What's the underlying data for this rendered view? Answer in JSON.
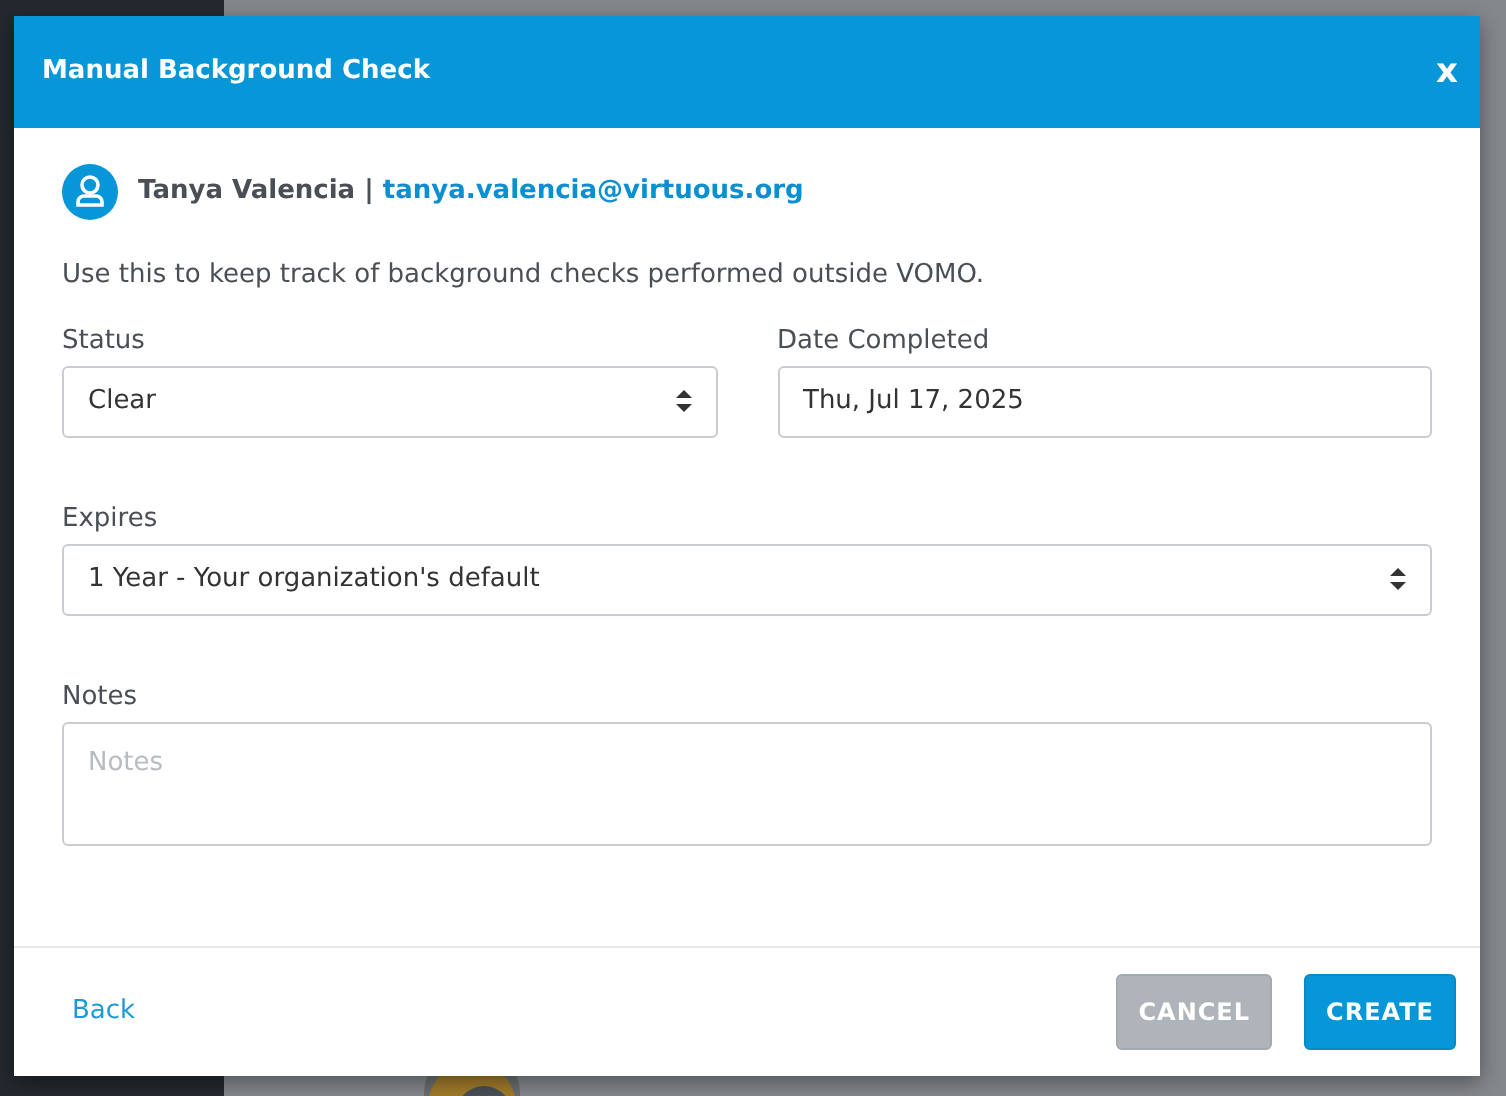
{
  "modal": {
    "title": "Manual Background Check",
    "close": "x",
    "user": {
      "name": "Tanya Valencia",
      "separator": "|",
      "email": "tanya.valencia@virtuous.org"
    },
    "description": "Use this to keep track of background checks performed outside VOMO.",
    "field_rows": [
      [
        {
          "kind": "select",
          "label": "Status",
          "value": "Clear"
        },
        {
          "kind": "date",
          "label": "Date Completed",
          "value": "Thu, Jul 17, 2025"
        }
      ],
      [
        {
          "kind": "select",
          "label": "Expires",
          "value": "1 Year - Your organization's default"
        }
      ],
      [
        {
          "kind": "textarea",
          "label": "Notes",
          "placeholder": "Notes"
        }
      ]
    ],
    "footer": {
      "back": "Back",
      "cancel": {
        "label": "CANCEL",
        "disabled": true
      },
      "create": {
        "label": "CREATE",
        "disabled": false
      }
    }
  }
}
